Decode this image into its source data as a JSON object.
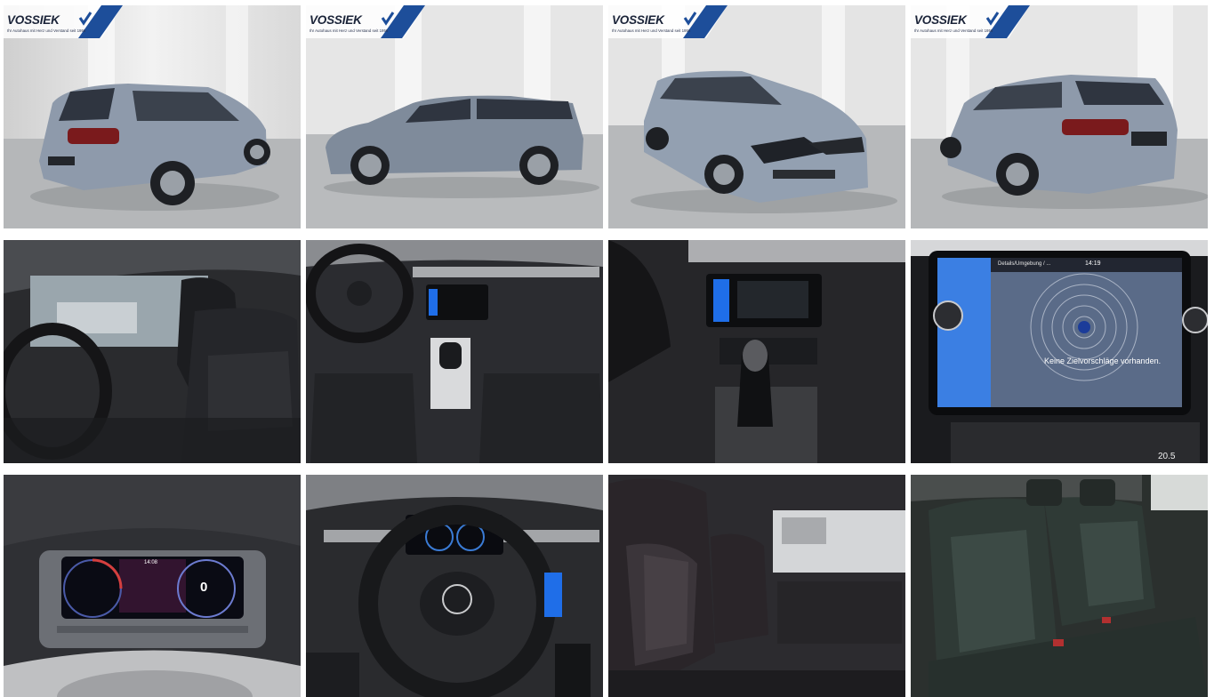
{
  "watermark": {
    "brand": "VOSSIEK",
    "tagline": "Ihr Autohaus mit Herz und Verstand seit 1956"
  },
  "photos": [
    {
      "name": "rear-three-quarter-left"
    },
    {
      "name": "side-profile-left"
    },
    {
      "name": "front-three-quarter"
    },
    {
      "name": "rear-three-quarter-right"
    },
    {
      "name": "interior-front-seats"
    },
    {
      "name": "dashboard-cockpit"
    },
    {
      "name": "center-console-gear-shifter"
    },
    {
      "name": "infotainment-navigation"
    },
    {
      "name": "digital-instrument-cluster"
    },
    {
      "name": "steering-wheel"
    },
    {
      "name": "front-passenger-seat"
    },
    {
      "name": "rear-bench-seat"
    }
  ],
  "nav_screen": {
    "message": "Keine Zielvorschläge vorhanden.",
    "header": "Details/Umgebung / ...",
    "time": "14:19"
  },
  "cluster": {
    "speed": "0",
    "time": "14:08"
  },
  "climate": {
    "temp": "20.5"
  },
  "colors": {
    "car_body": "#8e9aab",
    "studio_wall": "#e6e6e6",
    "floor": "#b7b9bb",
    "interior": "#1c1d20",
    "vw_screen_blue": "#1f6ee8",
    "tail_light": "#7a1a1c",
    "watermark_blue": "#1d4e9a"
  }
}
